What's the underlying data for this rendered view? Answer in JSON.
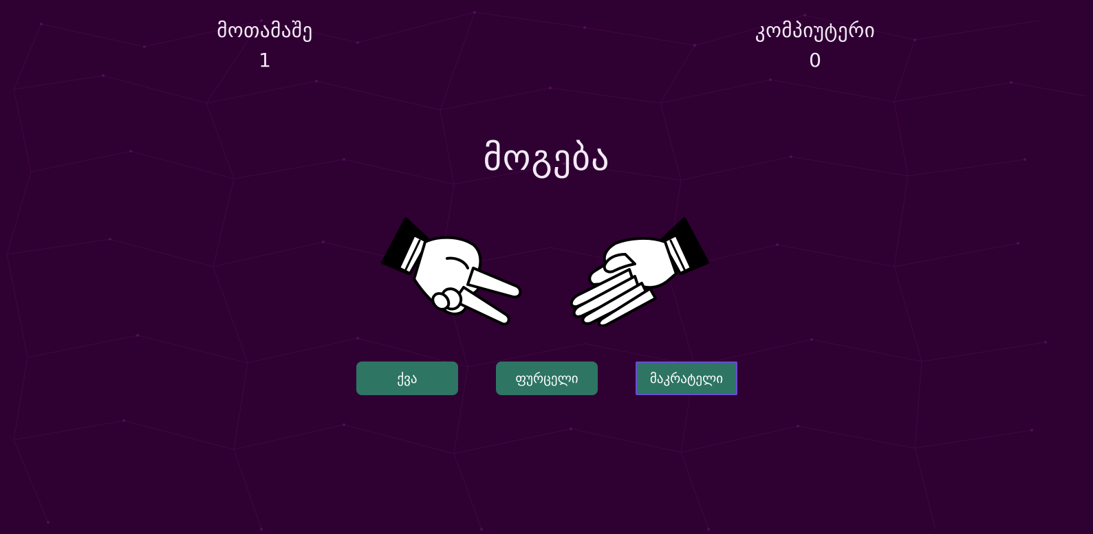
{
  "scoreboard": {
    "player": {
      "label": "მოთამაშე",
      "score": "1"
    },
    "computer": {
      "label": "კომპიუტერი",
      "score": "0"
    }
  },
  "result": {
    "text": "მოგება"
  },
  "hands": {
    "player_choice_icon": "scissors-hand-icon",
    "computer_choice_icon": "paper-hand-icon"
  },
  "buttons": {
    "rock": "ქვა",
    "paper": "ფურცელი",
    "scissors": "მაკრატელი"
  },
  "colors": {
    "background": "#2f0032",
    "button": "#2e7563",
    "text": "#f3eaf7",
    "focus_outline": "#6a4bd6"
  }
}
